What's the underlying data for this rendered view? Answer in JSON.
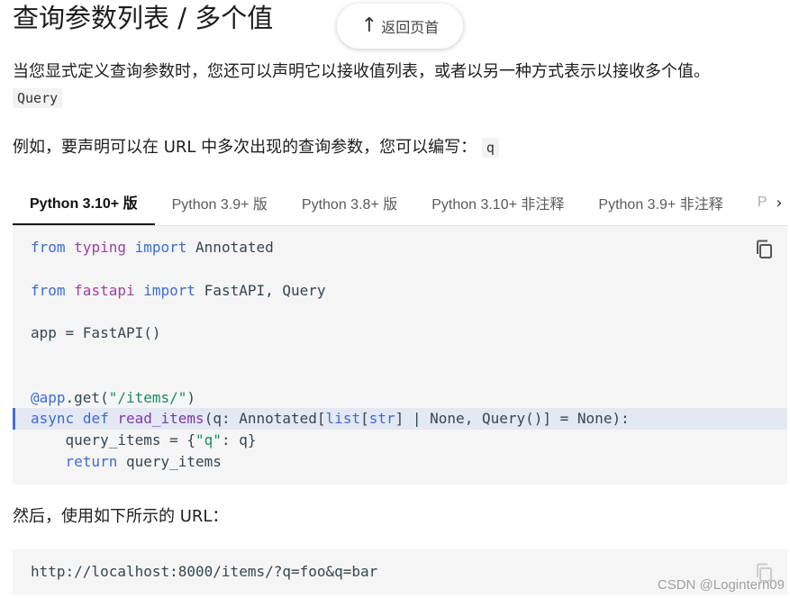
{
  "page_title": "查询参数列表 / 多个值",
  "back_to_top": "返回页首",
  "para1": "当您显式定义查询参数时，您还可以声明它以接收值列表，或者以另一种方式表示以接收多个值。",
  "query_chip": "Query",
  "para2_before": "例如，要声明可以在 URL 中多次出现的查询参数，您可以编写：",
  "para2_code": "q",
  "tabs": [
    {
      "label": "Python 3.10+ 版",
      "active": true
    },
    {
      "label": "Python 3.9+ 版",
      "active": false
    },
    {
      "label": "Python 3.8+ 版",
      "active": false
    },
    {
      "label": "Python 3.10+ 非注释",
      "active": false
    },
    {
      "label": "Python 3.9+ 非注释",
      "active": false
    },
    {
      "label": "P",
      "active": false
    }
  ],
  "code1": {
    "l1": {
      "kw1": "from",
      "mod": "typing",
      "kw2": "import",
      "rest": " Annotated"
    },
    "l2": {
      "kw1": "from",
      "mod": "fastapi",
      "kw2": "import",
      "rest": " FastAPI, Query"
    },
    "l3": "app = FastAPI()",
    "l4": {
      "deco": "@app",
      "mid": ".get(",
      "str": "\"/items/\"",
      "end": ")"
    },
    "l5": {
      "kw": "async",
      "kw2": "def",
      "fn": "read_items",
      "a": "(q: Annotated[",
      "list": "list",
      "b": "[",
      "strt": "str",
      "c": "] | None, Query()] = None):"
    },
    "l6": {
      "pre": "    query_items = {",
      "key": "\"q\"",
      "post": ": q}"
    },
    "l7": {
      "kw": "return",
      "rest": " query_items"
    }
  },
  "para3": "然后，使用如下所示的 URL：",
  "code2": "http://localhost:8000/items/?q=foo&q=bar",
  "watermark": "CSDN @Logintern09"
}
